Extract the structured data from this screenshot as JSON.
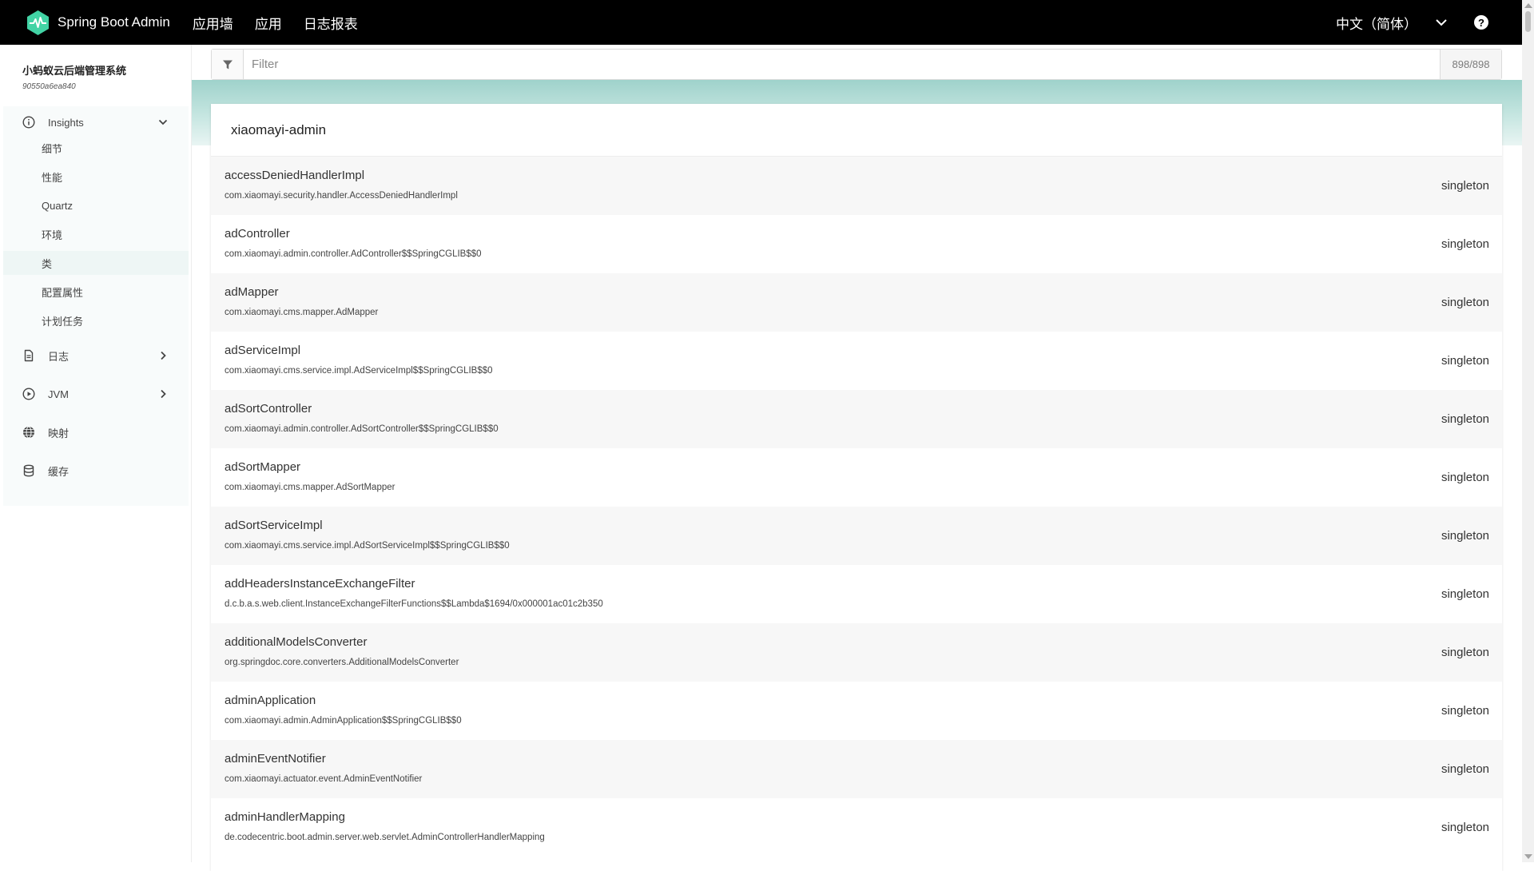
{
  "navbar": {
    "brand": "Spring Boot Admin",
    "items": [
      "应用墙",
      "应用",
      "日志报表"
    ],
    "language": "中文（简体）",
    "help_icon": "question-circle-icon",
    "logo_icon": "heartbeat-icon",
    "brand_color": "#42d3a5"
  },
  "sidebar": {
    "app_name": "小蚂蚁云后端管理系统",
    "instance_id": "90550a6ea840",
    "sections": [
      {
        "label": "Insights",
        "icon": "info-icon",
        "expanded": true
      },
      {
        "label": "日志",
        "icon": "file-icon"
      },
      {
        "label": "JVM",
        "icon": "play-circle-icon"
      },
      {
        "label": "映射",
        "icon": "globe-icon"
      },
      {
        "label": "缓存",
        "icon": "database-icon"
      }
    ],
    "insights_items": [
      "细节",
      "性能",
      "Quartz",
      "环境",
      "类",
      "配置属性",
      "计划任务"
    ],
    "active_item": "类"
  },
  "filter": {
    "placeholder": "Filter",
    "count": "898/898"
  },
  "card": {
    "title": "xiaomayi-admin",
    "beans": [
      {
        "name": "accessDeniedHandlerImpl",
        "type": "com.xiaomayi.security.handler.AccessDeniedHandlerImpl",
        "scope": "singleton"
      },
      {
        "name": "adController",
        "type": "com.xiaomayi.admin.controller.AdController$$SpringCGLIB$$0",
        "scope": "singleton"
      },
      {
        "name": "adMapper",
        "type": "com.xiaomayi.cms.mapper.AdMapper",
        "scope": "singleton"
      },
      {
        "name": "adServiceImpl",
        "type": "com.xiaomayi.cms.service.impl.AdServiceImpl$$SpringCGLIB$$0",
        "scope": "singleton"
      },
      {
        "name": "adSortController",
        "type": "com.xiaomayi.admin.controller.AdSortController$$SpringCGLIB$$0",
        "scope": "singleton"
      },
      {
        "name": "adSortMapper",
        "type": "com.xiaomayi.cms.mapper.AdSortMapper",
        "scope": "singleton"
      },
      {
        "name": "adSortServiceImpl",
        "type": "com.xiaomayi.cms.service.impl.AdSortServiceImpl$$SpringCGLIB$$0",
        "scope": "singleton"
      },
      {
        "name": "addHeadersInstanceExchangeFilter",
        "type": "d.c.b.a.s.web.client.InstanceExchangeFilterFunctions$$Lambda$1694/0x000001ac01c2b350",
        "scope": "singleton"
      },
      {
        "name": "additionalModelsConverter",
        "type": "org.springdoc.core.converters.AdditionalModelsConverter",
        "scope": "singleton"
      },
      {
        "name": "adminApplication",
        "type": "com.xiaomayi.admin.AdminApplication$$SpringCGLIB$$0",
        "scope": "singleton"
      },
      {
        "name": "adminEventNotifier",
        "type": "com.xiaomayi.actuator.event.AdminEventNotifier",
        "scope": "singleton"
      },
      {
        "name": "adminHandlerMapping",
        "type": "de.codecentric.boot.admin.server.web.servlet.AdminControllerHandlerMapping",
        "scope": "singleton"
      }
    ]
  }
}
